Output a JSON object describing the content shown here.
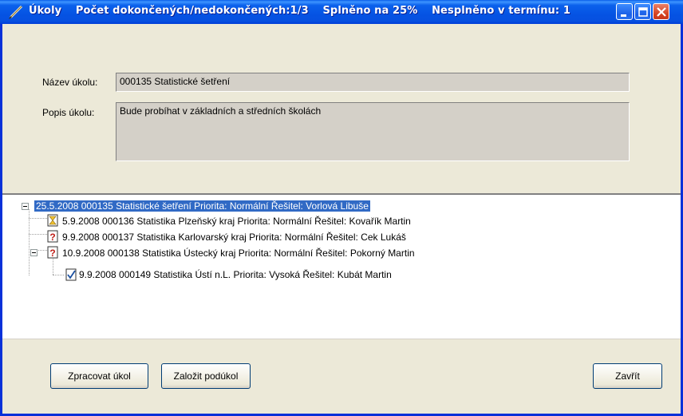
{
  "window": {
    "title_parts": [
      "Úkoly",
      "Počet dokončených/nedokončených:1/3",
      "Splněno na 25%",
      "Nesplněno v termínu: 1"
    ]
  },
  "form": {
    "name_label": "Název úkolu:",
    "name_value": "000135 Statistické šetření",
    "desc_label": "Popis úkolu:",
    "desc_value": "Bude probíhat v základních a středních školách"
  },
  "tree": {
    "items": [
      {
        "text": "25.5.2008  000135 Statistické šetření   Priorita: Normální   Řešitel: Vorlová Libuše",
        "icon": "none",
        "selected": true
      },
      {
        "text": "5.9.2008  000136 Statistika Plzeňský kraj  Priorita: Normální  Řešitel: Kovařík Martin",
        "icon": "hourglass-icon",
        "selected": false
      },
      {
        "text": "9.9.2008  000137 Statistika Karlovarský kraj  Priorita: Normální  Řešitel: Cek Lukáš",
        "icon": "question-icon",
        "selected": false
      },
      {
        "text": "10.9.2008  000138 Statistika Ústecký kraj  Priorita: Normální  Řešitel: Pokorný Martin",
        "icon": "question-icon",
        "selected": false
      },
      {
        "text": "9.9.2008  000149 Statistika Ústí n.L.  Priorita: Vysoká  Řešitel: Kubát Martin",
        "icon": "checked-icon",
        "selected": false
      }
    ]
  },
  "buttons": {
    "process": "Zpracovat úkol",
    "create_subtask": "Založit podúkol",
    "close": "Zavřít"
  },
  "colors": {
    "titlebar": "#0553e3",
    "selection": "#316ac5",
    "face": "#ece9d8"
  }
}
